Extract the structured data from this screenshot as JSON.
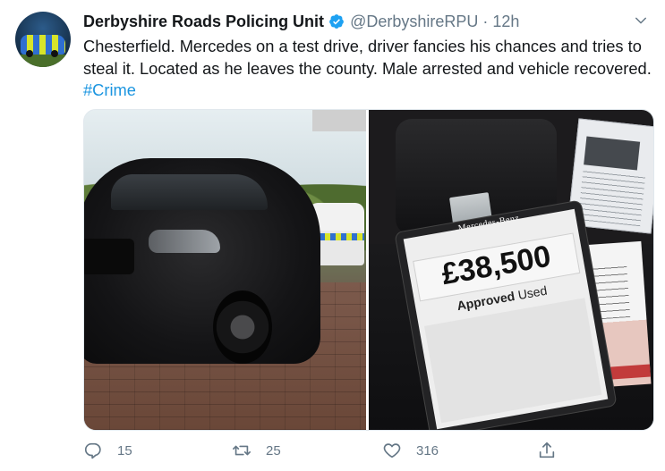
{
  "tweet": {
    "author": {
      "display_name": "Derbyshire Roads Policing Unit",
      "handle": "@DerbyshireRPU",
      "verified": true,
      "avatar_icon": "police-car-avatar"
    },
    "separator": "·",
    "timestamp": "12h",
    "text_main": "Chesterfield. Mercedes on a test drive, driver fancies his chances and tries to steal it. Located as he leaves the county. Male arrested and vehicle recovered. ",
    "hashtag": "#Crime",
    "media": {
      "right_photo": {
        "price_card": {
          "brand": "Mercedes-Benz",
          "price": "£38,500",
          "approved": "Approved",
          "used": "Used"
        }
      }
    },
    "actions": {
      "reply_count": "15",
      "retweet_count": "25",
      "like_count": "316",
      "reply_icon": "reply-icon",
      "retweet_icon": "retweet-icon",
      "like_icon": "heart-icon",
      "share_icon": "share-icon"
    }
  },
  "colors": {
    "text": "#14171a",
    "muted": "#657786",
    "link": "#1b95e0",
    "verified": "#1da1f2"
  }
}
